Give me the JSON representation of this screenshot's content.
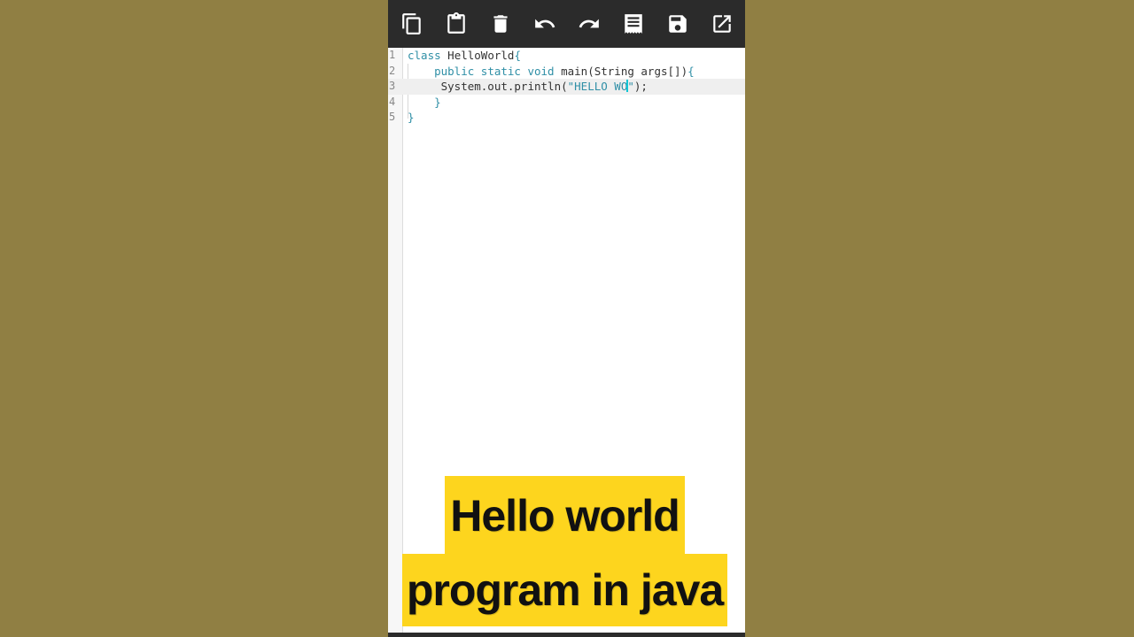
{
  "toolbar": {
    "buttons": [
      {
        "name": "copy-icon"
      },
      {
        "name": "paste-icon"
      },
      {
        "name": "delete-icon"
      },
      {
        "name": "undo-icon"
      },
      {
        "name": "redo-icon"
      },
      {
        "name": "format-icon"
      },
      {
        "name": "save-icon"
      },
      {
        "name": "open-external-icon"
      }
    ]
  },
  "editor": {
    "active_line": 3,
    "lines": [
      {
        "num": "1",
        "parts": [
          {
            "t": "class",
            "c": "kw"
          },
          {
            "t": " HelloWorld",
            "c": ""
          },
          {
            "t": "{",
            "c": "brace"
          }
        ]
      },
      {
        "num": "2",
        "parts": [
          {
            "t": "    ",
            "c": ""
          },
          {
            "t": "public static void",
            "c": "kw"
          },
          {
            "t": " main(String args[])",
            "c": ""
          },
          {
            "t": "{",
            "c": "brace"
          }
        ]
      },
      {
        "num": "3",
        "parts": [
          {
            "t": "     System.out.println(",
            "c": ""
          },
          {
            "t": "\"HELLO WO",
            "c": "str"
          },
          {
            "t": "|",
            "c": "cursor"
          },
          {
            "t": "\"",
            "c": "str"
          },
          {
            "t": ");",
            "c": ""
          }
        ]
      },
      {
        "num": "4",
        "parts": [
          {
            "t": "    ",
            "c": ""
          },
          {
            "t": "}",
            "c": "brace"
          }
        ]
      },
      {
        "num": "5",
        "parts": [
          {
            "t": "}",
            "c": "brace"
          }
        ]
      }
    ]
  },
  "caption": {
    "line1": "Hello world",
    "line2": "program in java"
  },
  "colors": {
    "background": "#907f43",
    "toolbar": "#2b2b2b",
    "caption_bg": "#fdd51e",
    "keyword": "#2f8fa6"
  }
}
